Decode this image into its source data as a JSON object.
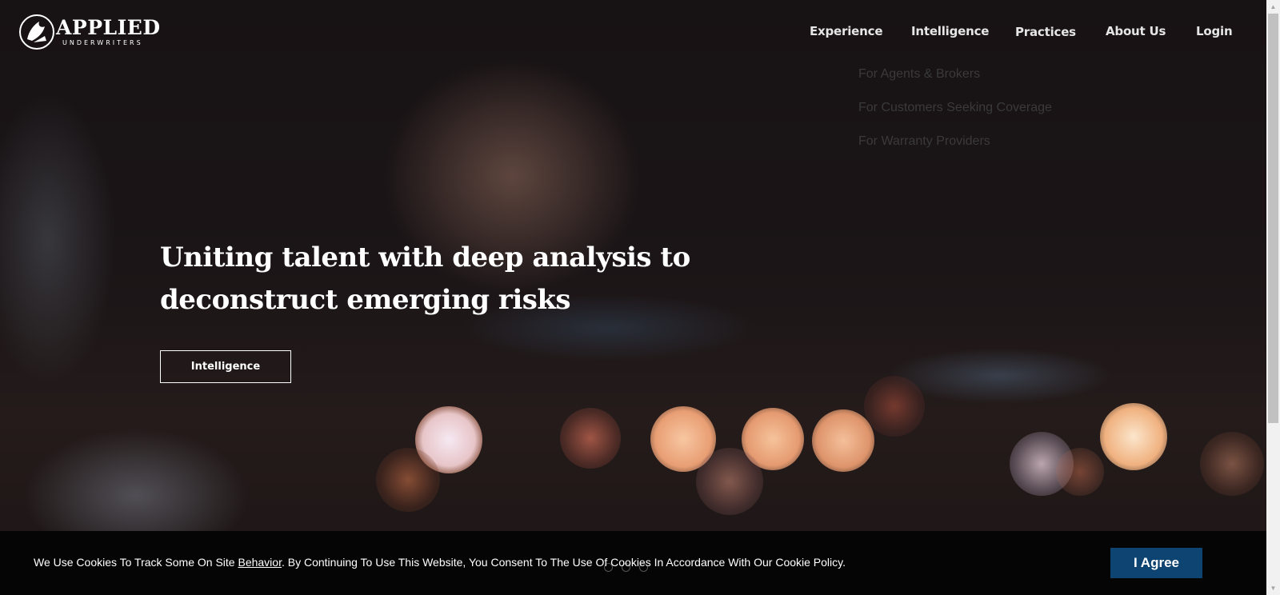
{
  "brand": {
    "name": "APPLIED",
    "tagline": "UNDERWRITERS"
  },
  "nav": {
    "items": [
      {
        "label": "Experience"
      },
      {
        "label": "Intelligence"
      },
      {
        "label": "Practices"
      },
      {
        "label": "About Us"
      },
      {
        "label": "Login"
      }
    ],
    "dropdown": [
      {
        "label": "For Agents & Brokers"
      },
      {
        "label": "For Customers Seeking Coverage"
      },
      {
        "label": "For Warranty Providers"
      }
    ]
  },
  "hero": {
    "headline": "Uniting talent with deep analysis to deconstruct emerging risks",
    "cta_label": "Intelligence"
  },
  "cookie": {
    "text_before": "We Use Cookies To Track Some On Site ",
    "link": "Behavior",
    "text_after": ". By Continuing To Use This Website, You Consent To The Use Of Cookies In Accordance With Our Cookie Policy.",
    "agree_label": "I Agree"
  },
  "colors": {
    "agree_button": "#0e4471",
    "cookie_bar": "#050505"
  }
}
